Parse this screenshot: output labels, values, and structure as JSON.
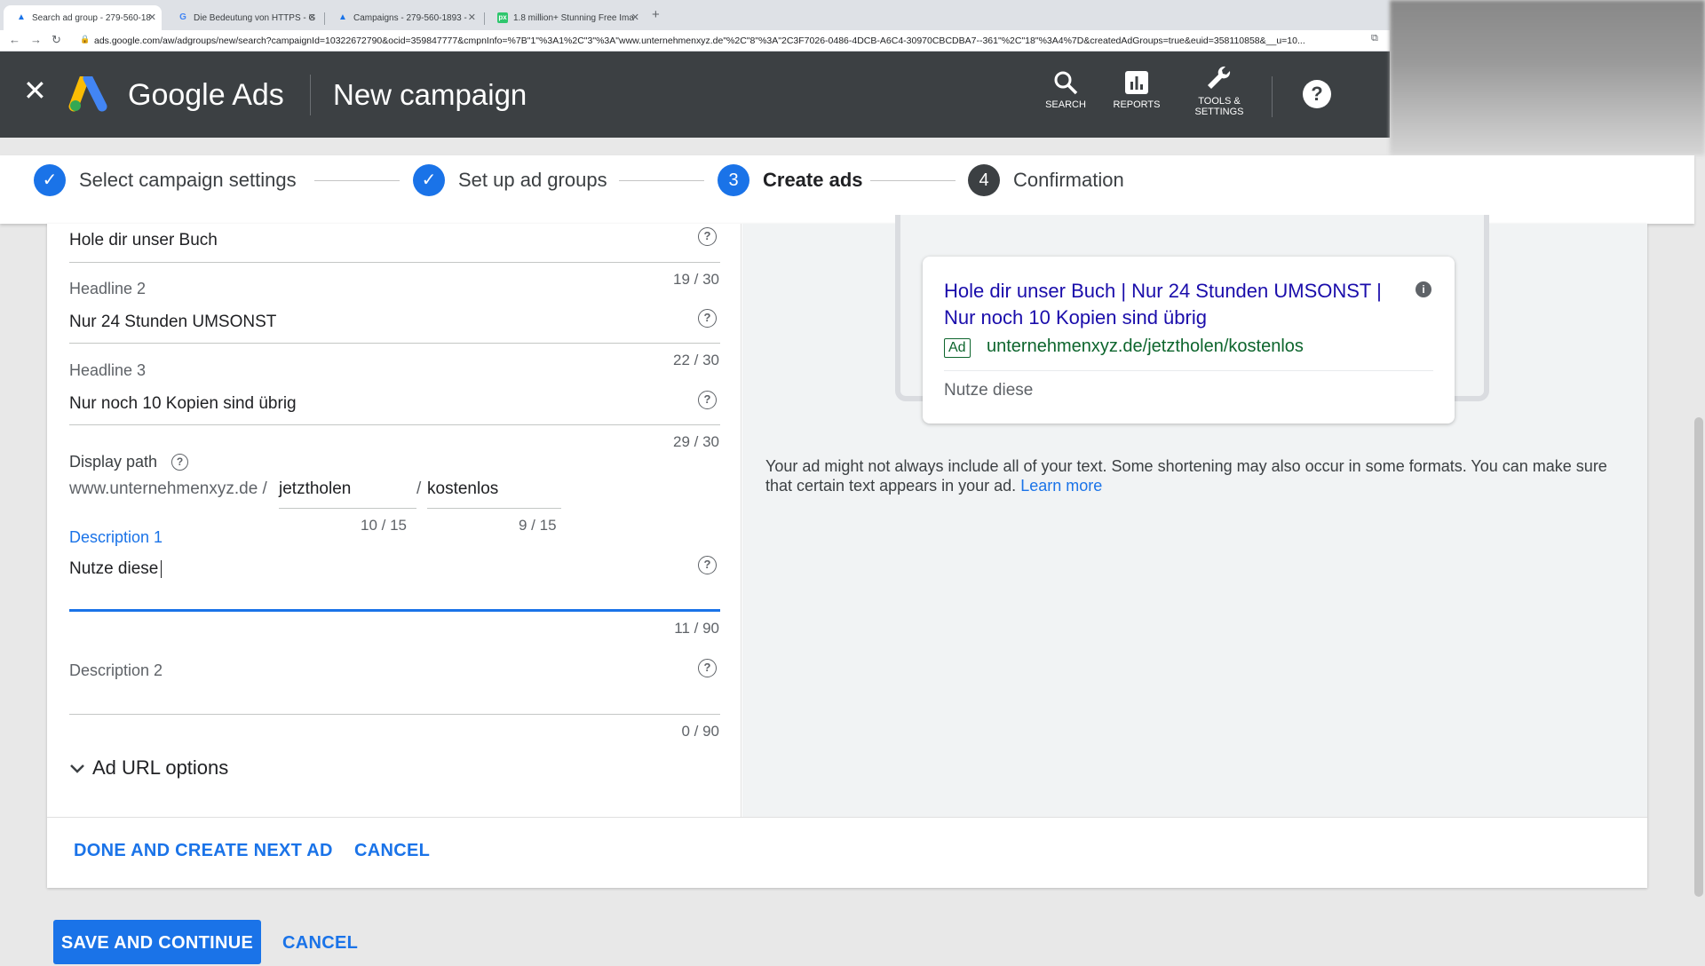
{
  "browser": {
    "tabs": [
      {
        "title": "Search ad group - 279-560-18",
        "icon": "google-ads-icon"
      },
      {
        "title": "Die Bedeutung von HTTPS - G",
        "icon": "google-icon"
      },
      {
        "title": "Campaigns - 279-560-1893 -",
        "icon": "google-ads-icon"
      },
      {
        "title": "1.8 million+ Stunning Free Ima",
        "icon": "pixabay-icon"
      }
    ],
    "new_tab": "+",
    "url": "ads.google.com/aw/adgroups/new/search?campaignId=10322672790&ocid=359847777&cmpnInfo=%7B\"1\"%3A1%2C\"3\"%3A\"www.unternehmenxyz.de\"%2C\"8\"%3A\"2C3F7026-0486-4DCB-A6C4-30970CBCDBA7--361\"%2C\"18\"%3A4%7D&createdAdGroups=true&euid=358110858&__u=10..."
  },
  "header": {
    "close": "✕",
    "brand": "Google Ads",
    "title": "New campaign",
    "tools": [
      {
        "label": "SEARCH",
        "icon": "search-icon"
      },
      {
        "label": "REPORTS",
        "icon": "reports-icon"
      },
      {
        "label_line1": "TOOLS &",
        "label_line2": "SETTINGS",
        "icon": "wrench-icon"
      }
    ],
    "help": "?"
  },
  "stepper": {
    "steps": [
      {
        "label": "Select campaign settings",
        "state": "done",
        "mark": "✓"
      },
      {
        "label": "Set up ad groups",
        "state": "done",
        "mark": "✓"
      },
      {
        "label": "Create ads",
        "state": "active",
        "mark": "3"
      },
      {
        "label": "Confirmation",
        "state": "idle",
        "mark": "4"
      }
    ]
  },
  "form": {
    "headline1": {
      "value": "Hole dir unser Buch",
      "count": "19 / 30"
    },
    "headline2": {
      "label": "Headline 2",
      "value": "Nur 24 Stunden UMSONST",
      "count": "22 / 30"
    },
    "headline3": {
      "label": "Headline 3",
      "value": "Nur noch 10 Kopien sind übrig",
      "count": "29 / 30"
    },
    "display_path": {
      "label": "Display path",
      "base": "www.unternehmenxyz.de /",
      "path1": "jetztholen",
      "sep": "/",
      "path2": "kostenlos",
      "count1": "10 / 15",
      "count2": "9 / 15"
    },
    "description1": {
      "label": "Description 1",
      "value": "Nutze diese",
      "count": "11 / 90"
    },
    "description2": {
      "label": "Description 2",
      "value": "",
      "count": "0 / 90"
    },
    "url_options": "Ad URL options",
    "help_mark": "?"
  },
  "preview": {
    "headline": "Hole dir unser Buch | Nur 24 Stunden UMSONST | Nur noch 10 Kopien sind übrig",
    "info": "i",
    "badge": "Ad",
    "display_url": "unternehmenxyz.de/jetztholen/kostenlos",
    "description": "Nutze diese",
    "note": "Your ad might not always include all of your text. Some shortening may also occur in some formats. You can make sure that certain text appears in your ad.",
    "learn_more": "Learn more"
  },
  "actions": {
    "done_next": "DONE AND CREATE NEXT AD",
    "cancel": "CANCEL",
    "save_continue": "SAVE AND CONTINUE",
    "bottom_cancel": "CANCEL"
  },
  "colors": {
    "accent": "#1a73e8",
    "header_bg": "#3c4043",
    "ad_link": "#1a0dab",
    "ad_url": "#0d652d"
  }
}
